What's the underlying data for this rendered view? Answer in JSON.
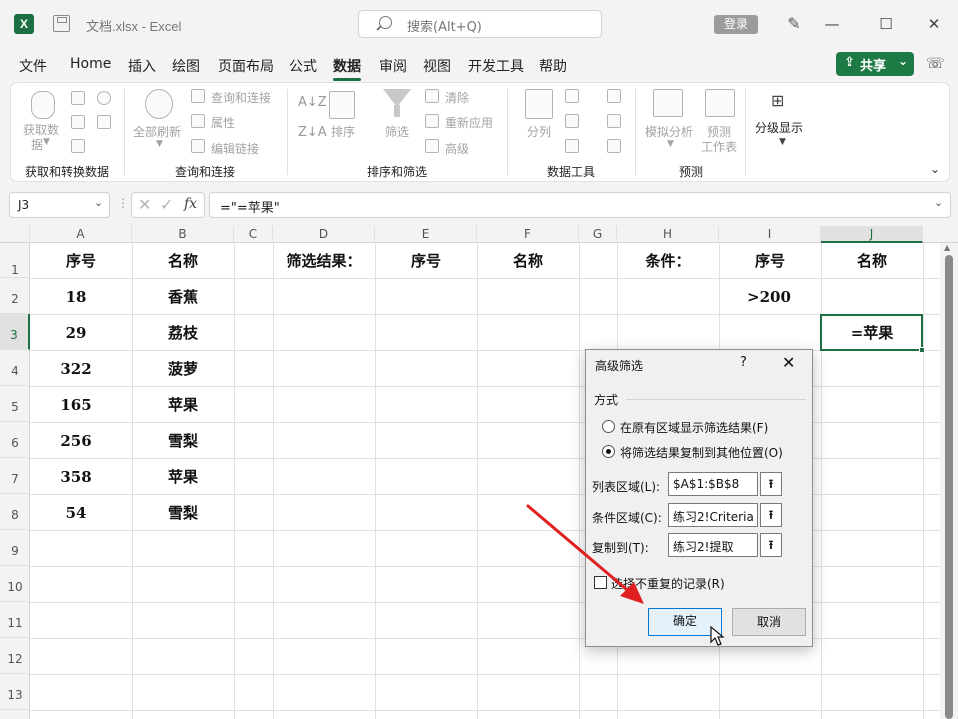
{
  "titlebar": {
    "app_logo": "X",
    "doc_title": "文档.xlsx  -  Excel",
    "search_placeholder": "搜索(Alt+Q)",
    "login_label": "登录",
    "minimize_glyph": "—",
    "maximize_glyph": "☐",
    "close_glyph": "✕"
  },
  "menu": {
    "items": [
      "文件",
      "Home",
      "插入",
      "绘图",
      "页面布局",
      "公式",
      "数据",
      "审阅",
      "视图",
      "开发工具",
      "帮助"
    ],
    "active": "数据",
    "share_label": "共享"
  },
  "ribbon": {
    "groups": [
      "获取和转换数据",
      "查询和连接",
      "排序和筛选",
      "数据工具",
      "预测"
    ],
    "get_data_label_1": "获取数",
    "get_data_label_2": "据",
    "refresh_all_label": "全部刷新",
    "queries_connections_label": "查询和连接",
    "properties_label": "属性",
    "edit_links_label": "编辑链接",
    "sort_label": "排序",
    "filter_label": "筛选",
    "clear_label": "清除",
    "reapply_label": "重新应用",
    "advanced_label": "高级",
    "text_to_columns_label": "分列",
    "what_if_label": "模拟分析",
    "forecast_sheet_label_1": "预测",
    "forecast_sheet_label_2": "工作表",
    "outline_label": "分级显示"
  },
  "formula_bar": {
    "name_box": "J3",
    "formula": "=\"=苹果\"",
    "fx": "fx"
  },
  "sheet": {
    "columns": [
      "A",
      "B",
      "C",
      "D",
      "E",
      "F",
      "G",
      "H",
      "I",
      "J"
    ],
    "rows": [
      "1",
      "2",
      "3",
      "4",
      "5",
      "6",
      "7",
      "8",
      "9",
      "10",
      "11",
      "12",
      "13"
    ],
    "header_A1": "序号",
    "header_B1": "名称",
    "header_D1": "筛选结果：",
    "header_E1": "序号",
    "header_F1": "名称",
    "header_H1": "条件：",
    "header_I1": "序号",
    "header_J1": "名称",
    "data": [
      {
        "seq": "18",
        "name": "香蕉"
      },
      {
        "seq": "29",
        "name": "荔枝"
      },
      {
        "seq": "322",
        "name": "菠萝"
      },
      {
        "seq": "165",
        "name": "苹果"
      },
      {
        "seq": "256",
        "name": "雪梨"
      },
      {
        "seq": "358",
        "name": "苹果"
      },
      {
        "seq": "54",
        "name": "雪梨"
      }
    ],
    "criteria_I2": ">200",
    "criteria_J3": "=苹果"
  },
  "dialog": {
    "title": "高级筛选",
    "help": "?",
    "close": "✕",
    "mode_label": "方式",
    "radio_inplace": "在原有区域显示筛选结果(F)",
    "radio_copy": "将筛选结果复制到其他位置(O)",
    "list_range_label": "列表区域(L):",
    "list_range_value": "$A$1:$B$8",
    "criteria_range_label": "条件区域(C):",
    "criteria_range_value": "练习2!Criteria",
    "copy_to_label": "复制到(T):",
    "copy_to_value": "练习2!提取",
    "unique_label": "选择不重复的记录(R)",
    "ok_label": "确定",
    "cancel_label": "取消",
    "collapse_glyph": "⭱"
  },
  "colors": {
    "accent": "#1d6f42",
    "annotation_arrow": "#e02020",
    "dialog_default_button": "#0078d4"
  }
}
